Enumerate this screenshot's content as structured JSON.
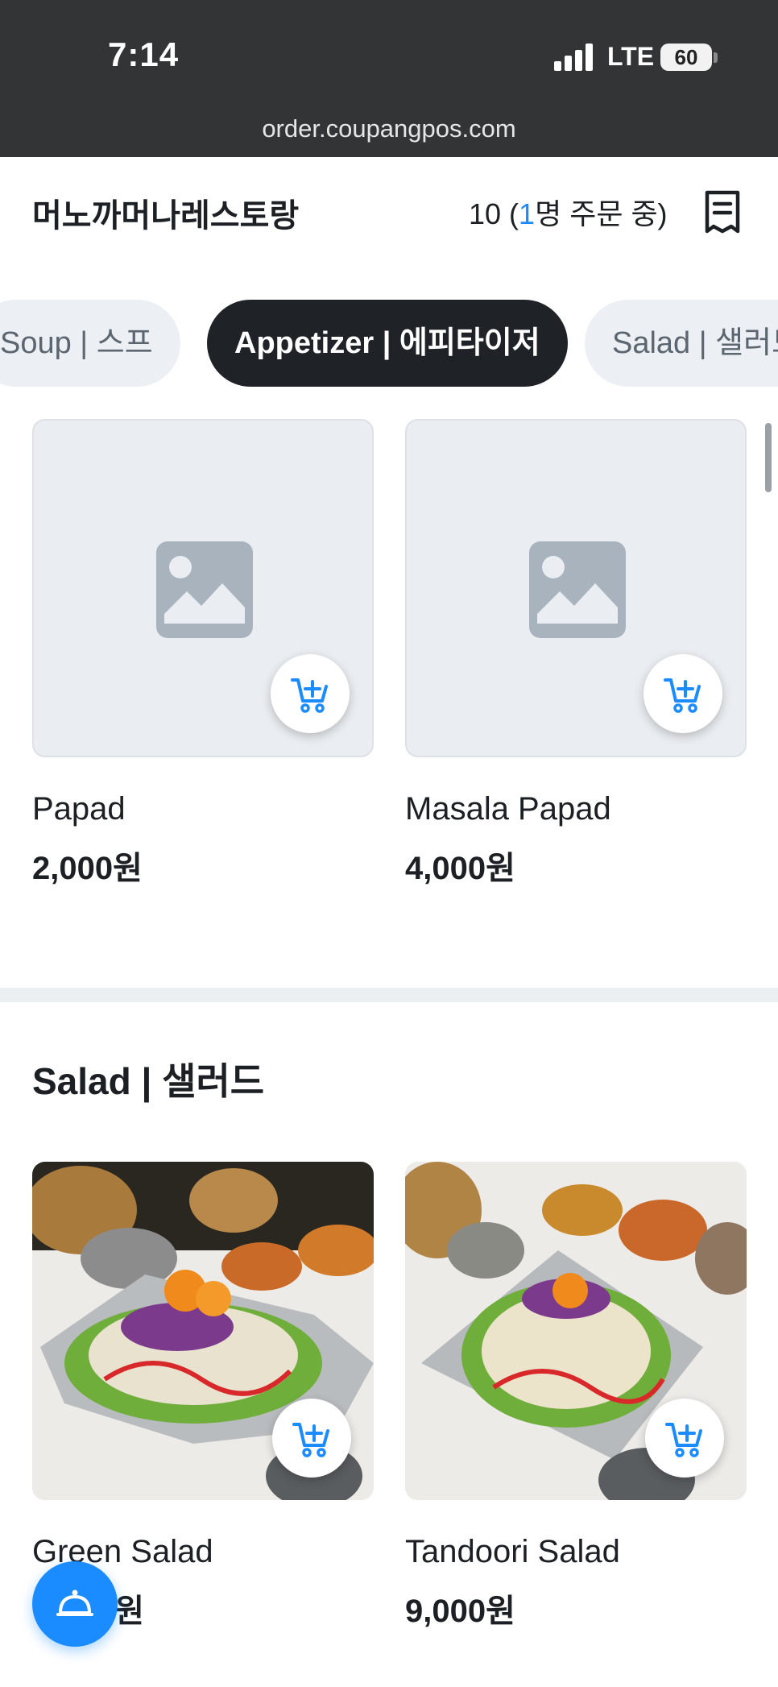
{
  "status_bar": {
    "time": "7:14",
    "network": "LTE",
    "battery": "60",
    "url": "order.coupangpos.com"
  },
  "header": {
    "store_name": "머노까머나레스토랑",
    "table_number": "10 (",
    "people_count": "1",
    "ordering_suffix": "명 주문 중)",
    "receipt_icon": "receipt-icon"
  },
  "tabs": [
    {
      "label": "Soup | 스프",
      "active": false
    },
    {
      "label": "Appetizer | 에피타이저",
      "active": true
    },
    {
      "label": "Salad | 샐러드",
      "active": false
    }
  ],
  "appetizer_items": [
    {
      "name": "Papad",
      "price": "2,000원",
      "image": "placeholder-image-icon"
    },
    {
      "name": "Masala Papad",
      "price": "4,000원",
      "image": "placeholder-image-icon"
    }
  ],
  "salad_section": {
    "title": "Salad | 샐러드",
    "items": [
      {
        "name": "Green Salad",
        "price": "0원",
        "image": "salad-photo"
      },
      {
        "name": "Tandoori Salad",
        "price": "9,000원",
        "image": "salad-photo"
      }
    ]
  },
  "colors": {
    "accent": "#1a8cff",
    "dark": "#1f2328",
    "tab_inactive": "#eceff3"
  },
  "fab_icon": "bell-icon"
}
